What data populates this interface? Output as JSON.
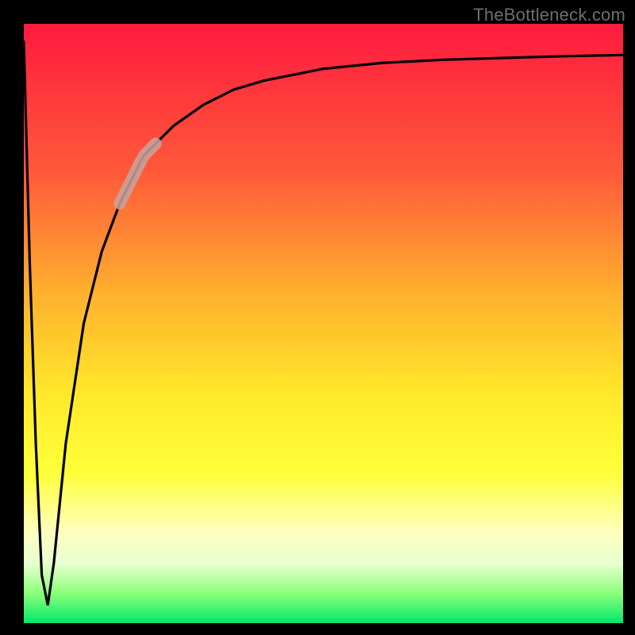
{
  "watermark": "TheBottleneck.com",
  "chart_data": {
    "type": "line",
    "title": "",
    "xlabel": "",
    "ylabel": "",
    "xlim": [
      0,
      100
    ],
    "ylim": [
      0,
      100
    ],
    "grid": false,
    "series": [
      {
        "name": "main-curve",
        "x": [
          0,
          1,
          2,
          3,
          4,
          5,
          7,
          10,
          13,
          16,
          20,
          25,
          30,
          35,
          40,
          50,
          60,
          70,
          80,
          90,
          100
        ],
        "y": [
          97,
          60,
          30,
          8,
          3,
          10,
          30,
          50,
          62,
          70,
          78,
          83,
          86.5,
          89,
          90.5,
          92.5,
          93.5,
          94,
          94.3,
          94.6,
          94.8
        ]
      }
    ],
    "highlight_segment": {
      "x_start": 16,
      "x_end": 22,
      "note": "pale overlay band on curve"
    },
    "background_gradient": {
      "direction": "vertical",
      "stops": [
        {
          "y": 100,
          "color": "#ff1a3e"
        },
        {
          "y": 75,
          "color": "#ff5a3a"
        },
        {
          "y": 55,
          "color": "#ffb02e"
        },
        {
          "y": 38,
          "color": "#ffe92a"
        },
        {
          "y": 25,
          "color": "#ffff3a"
        },
        {
          "y": 15,
          "color": "#fdffc0"
        },
        {
          "y": 10,
          "color": "#e9ffd0"
        },
        {
          "y": 5,
          "color": "#8cff7a"
        },
        {
          "y": 0,
          "color": "#00e96a"
        }
      ]
    }
  }
}
